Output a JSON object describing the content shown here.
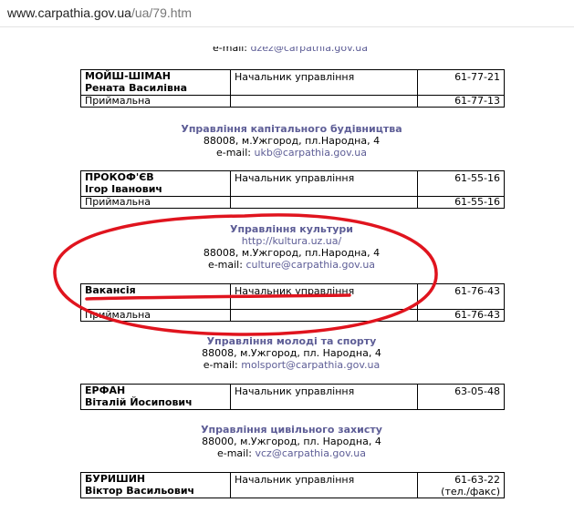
{
  "browser": {
    "url_host": "www.carpathia.gov.ua",
    "url_path": "/ua/79.htm"
  },
  "top_cut": {
    "email_label": "e-mail:",
    "email": "dzez@carpathia.gov.ua"
  },
  "labels": {
    "head": "Начальник управління",
    "reception": "Приймальна",
    "email_label": "e-mail:"
  },
  "blocks": [
    {
      "name_line1": "МОЙШ-ШІМАН",
      "name_line2": "Рената Василівна",
      "phone": "61-77-21",
      "reception_phone": "61-77-13"
    },
    {
      "dept_title": "Управління капітального будівництва",
      "dept_address": "88008, м.Ужгород, пл.Народна, 4",
      "dept_email": "ukb@carpathia.gov.ua",
      "name_line1": "ПРОКОФ'ЄВ",
      "name_line2": "Ігор Іванович",
      "phone": "61-55-16",
      "reception_phone": "61-55-16"
    },
    {
      "dept_title": "Управління культури",
      "dept_site": "http://kultura.uz.ua/",
      "dept_address": "88008, м.Ужгород, пл.Народна, 4",
      "dept_email": "culture@carpathia.gov.ua",
      "name_line1": "Вакансія",
      "phone": "61-76-43",
      "reception_phone": "61-76-43"
    },
    {
      "dept_title": "Управління молоді та спорту",
      "dept_address": "88008, м.Ужгород, пл. Народна, 4",
      "dept_email": "molsport@carpathia.gov.ua",
      "name_line1": "ЕРФАН",
      "name_line2": "Віталій Йосипович",
      "phone": "63-05-48"
    },
    {
      "dept_title": "Управління цивільного захисту",
      "dept_address": "88000, м.Ужгород, пл. Народна, 4",
      "dept_email": "vcz@carpathia.gov.ua",
      "name_line1": "БУРИШИН",
      "name_line2": "Віктор Васильович",
      "phone": "61-63-22",
      "phone_note": "(тел./факс)"
    }
  ],
  "colors": {
    "link": "#5d5d96",
    "annotation": "#e0141e"
  }
}
